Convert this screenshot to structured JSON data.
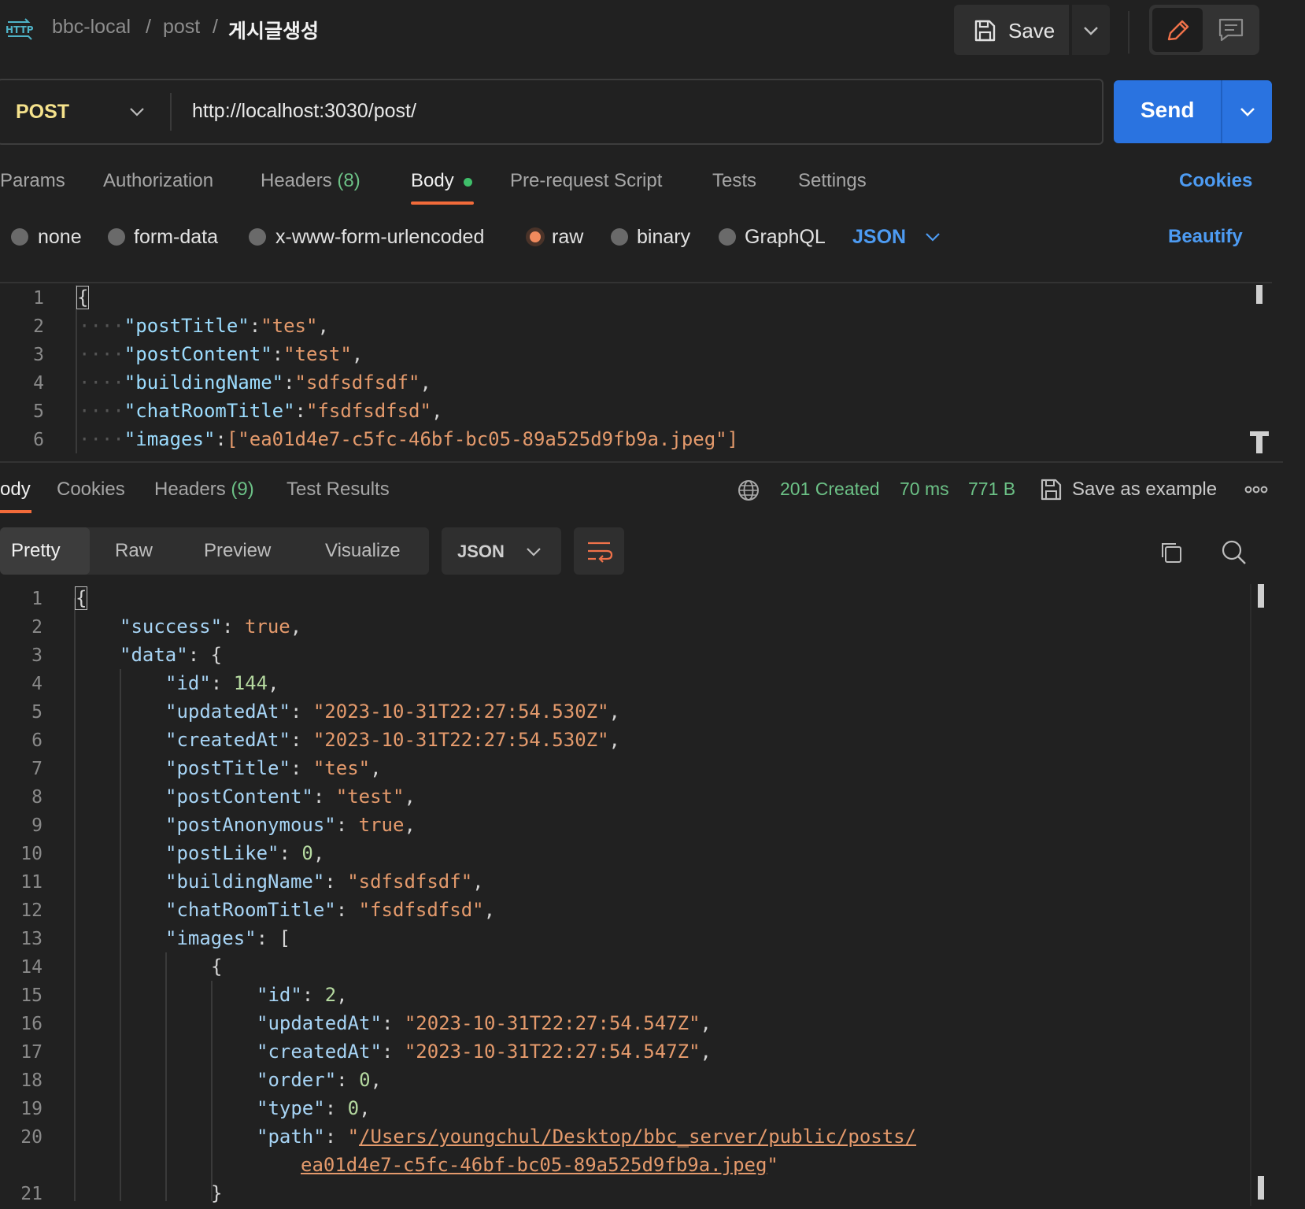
{
  "breadcrumb": {
    "collection": "bbc-local",
    "folder": "post",
    "request": "게시글생성",
    "sep1": "/",
    "sep2": "/",
    "protocol": "HTTP"
  },
  "toolbar": {
    "save_label": "Save"
  },
  "request": {
    "method": "POST",
    "url": "http://localhost:3030/post/",
    "send_label": "Send"
  },
  "request_tabs": {
    "params": "Params",
    "authorization": "Authorization",
    "headers": "Headers",
    "headers_count": "(8)",
    "body": "Body",
    "prerequest": "Pre-request Script",
    "tests": "Tests",
    "settings": "Settings",
    "cookies": "Cookies"
  },
  "body_types": {
    "none": "none",
    "form_data": "form-data",
    "urlencoded": "x-www-form-urlencoded",
    "raw": "raw",
    "binary": "binary",
    "graphql": "GraphQL",
    "format": "JSON",
    "beautify": "Beautify"
  },
  "request_body": {
    "line_numbers": [
      "1",
      "2",
      "3",
      "4",
      "5",
      "6"
    ],
    "open_brace": "{",
    "fields": [
      {
        "key": "\"postTitle\"",
        "value": "\"tes\"",
        "tail": ","
      },
      {
        "key": "\"postContent\"",
        "value": "\"test\"",
        "tail": ","
      },
      {
        "key": "\"buildingName\"",
        "value": "\"sdfsdfsdf\"",
        "tail": ","
      },
      {
        "key": "\"chatRoomTitle\"",
        "value": "\"fsdfsdfsd\"",
        "tail": ","
      },
      {
        "key": "\"images\"",
        "value": "[\"ea01d4e7-c5fc-46bf-bc05-89a525d9fb9a.jpeg\"]",
        "tail": ""
      }
    ]
  },
  "response_tabs": {
    "body": "ody",
    "cookies": "Cookies",
    "headers": "Headers",
    "headers_count": "(9)",
    "test_results": "Test Results"
  },
  "response_status": {
    "status": "201 Created",
    "time": "70 ms",
    "size": "771 B",
    "save_example": "Save as example"
  },
  "view_modes": {
    "pretty": "Pretty",
    "raw": "Raw",
    "preview": "Preview",
    "visualize": "Visualize",
    "format": "JSON"
  },
  "response_body": {
    "line_numbers": [
      "1",
      "2",
      "3",
      "4",
      "5",
      "6",
      "7",
      "8",
      "9",
      "10",
      "11",
      "12",
      "13",
      "14",
      "15",
      "16",
      "17",
      "18",
      "19",
      "20",
      "",
      "21"
    ],
    "l1": "{",
    "l2_key": "\"success\"",
    "l2_val": "true",
    "l3_key": "\"data\"",
    "l3_open": "{",
    "l4_key": "\"id\"",
    "l4_val": "144",
    "l5_key": "\"updatedAt\"",
    "l5_val": "\"2023-10-31T22:27:54.530Z\"",
    "l6_key": "\"createdAt\"",
    "l6_val": "\"2023-10-31T22:27:54.530Z\"",
    "l7_key": "\"postTitle\"",
    "l7_val": "\"tes\"",
    "l8_key": "\"postContent\"",
    "l8_val": "\"test\"",
    "l9_key": "\"postAnonymous\"",
    "l9_val": "true",
    "l10_key": "\"postLike\"",
    "l10_val": "0",
    "l11_key": "\"buildingName\"",
    "l11_val": "\"sdfsdfsdf\"",
    "l12_key": "\"chatRoomTitle\"",
    "l12_val": "\"fsdfsdfsd\"",
    "l13_key": "\"images\"",
    "l13_open": "[",
    "l14": "{",
    "l15_key": "\"id\"",
    "l15_val": "2",
    "l16_key": "\"updatedAt\"",
    "l16_val": "\"2023-10-31T22:27:54.547Z\"",
    "l17_key": "\"createdAt\"",
    "l17_val": "\"2023-10-31T22:27:54.547Z\"",
    "l18_key": "\"order\"",
    "l18_val": "0",
    "l19_key": "\"type\"",
    "l19_val": "0",
    "l20_key": "\"path\"",
    "l20_q": "\"",
    "l20_val_a": "/Users/youngchul/Desktop/bbc_server/public/posts/",
    "l20_val_b": "ea01d4e7-c5fc-46bf-bc05-89a525d9fb9a.jpeg",
    "l20_q2": "\"",
    "l21": "}"
  },
  "colors": {
    "accent_orange": "#f26b3a",
    "send_blue": "#2a73e0",
    "link_blue": "#4d9bf2",
    "success_green": "#6cc186",
    "method_yellow": "#f5e28c"
  }
}
